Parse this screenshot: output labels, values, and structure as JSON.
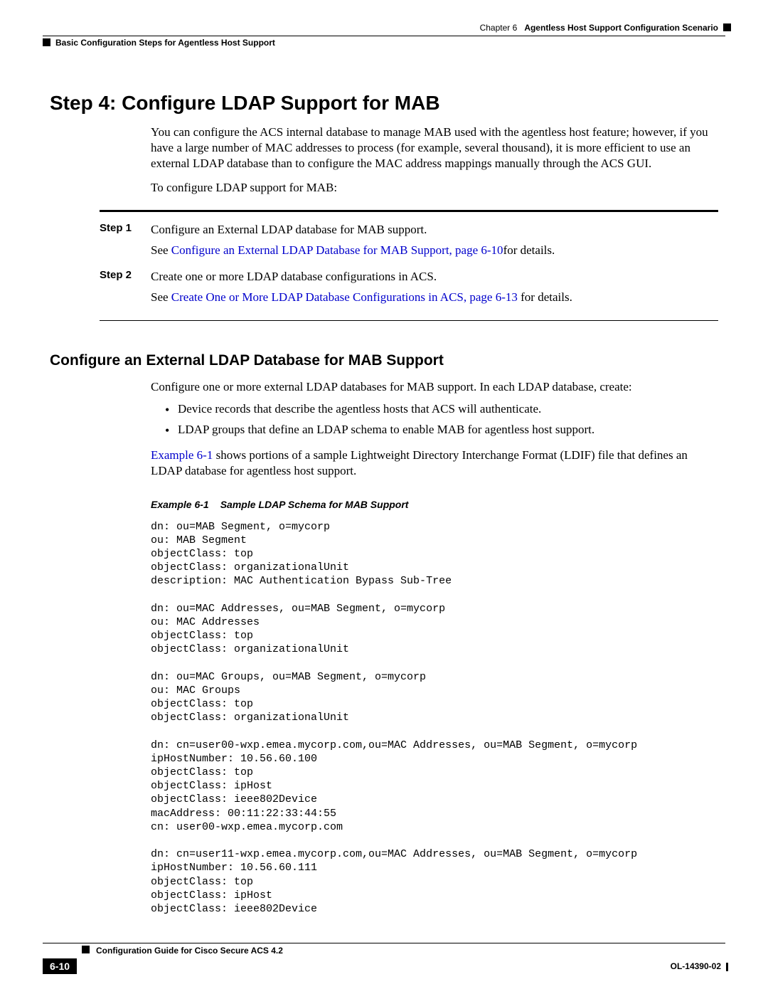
{
  "header": {
    "chapter_label": "Chapter 6",
    "chapter_title": "Agentless Host Support Configuration Scenario",
    "section": "Basic Configuration Steps for Agentless Host Support"
  },
  "h1": "Step 4: Configure LDAP Support for MAB",
  "intro_p1": "You can configure the ACS internal database to manage MAB used with the agentless host feature; however, if you have a large number of MAC addresses to process (for example, several thousand), it is more efficient to use an external LDAP database than to configure the MAC address mappings manually through the ACS GUI.",
  "intro_p2": "To configure LDAP support for MAB:",
  "steps": [
    {
      "label": "Step 1",
      "line1": "Configure an External LDAP database for MAB support.",
      "see": "See ",
      "link": "Configure an External LDAP Database for MAB Support, page 6-10",
      "after": "for details."
    },
    {
      "label": "Step 2",
      "line1": "Create one or more LDAP database configurations in ACS.",
      "see": "See ",
      "link": "Create One or More LDAP Database Configurations in ACS, page 6-13",
      "after": " for details."
    }
  ],
  "h2": "Configure an External LDAP Database for MAB Support",
  "section2_p1": "Configure one or more external LDAP databases for MAB support. In each LDAP database, create:",
  "bullets": [
    "Device records that describe the agentless hosts that ACS will authenticate.",
    "LDAP groups that define an LDAP schema to enable MAB for agentless host support."
  ],
  "section2_p2_link": "Example 6-1",
  "section2_p2_rest": " shows portions of a sample Lightweight Directory Interchange Format (LDIF) file that defines an LDAP database for agentless host support.",
  "example_label": "Example 6-1",
  "example_title": "Sample LDAP Schema for MAB Support",
  "code": "dn: ou=MAB Segment, o=mycorp\nou: MAB Segment\nobjectClass: top\nobjectClass: organizationalUnit\ndescription: MAC Authentication Bypass Sub-Tree\n\ndn: ou=MAC Addresses, ou=MAB Segment, o=mycorp\nou: MAC Addresses\nobjectClass: top\nobjectClass: organizationalUnit\n\ndn: ou=MAC Groups, ou=MAB Segment, o=mycorp\nou: MAC Groups\nobjectClass: top\nobjectClass: organizationalUnit\n\ndn: cn=user00-wxp.emea.mycorp.com,ou=MAC Addresses, ou=MAB Segment, o=mycorp\nipHostNumber: 10.56.60.100\nobjectClass: top\nobjectClass: ipHost\nobjectClass: ieee802Device\nmacAddress: 00:11:22:33:44:55\ncn: user00-wxp.emea.mycorp.com\n\ndn: cn=user11-wxp.emea.mycorp.com,ou=MAC Addresses, ou=MAB Segment, o=mycorp\nipHostNumber: 10.56.60.111\nobjectClass: top\nobjectClass: ipHost\nobjectClass: ieee802Device",
  "footer": {
    "guide_title": "Configuration Guide for Cisco Secure ACS 4.2",
    "page_number": "6-10",
    "doc_id": "OL-14390-02"
  }
}
